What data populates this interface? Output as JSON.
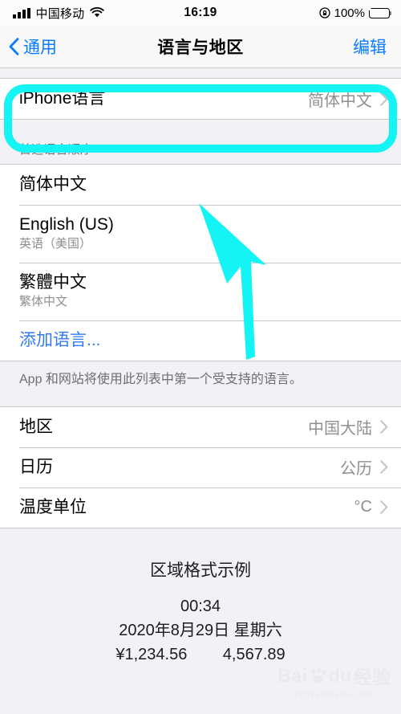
{
  "status_bar": {
    "carrier": "中国移动",
    "time": "16:19",
    "battery_percent": "100%",
    "signal_icon": "signal-bars-icon",
    "wifi_icon": "wifi-icon",
    "rotation_lock_icon": "rotation-lock-icon",
    "battery_icon": "battery-charging-icon"
  },
  "nav": {
    "back_label": "通用",
    "title": "语言与地区",
    "edit_label": "编辑"
  },
  "iphone_language": {
    "label": "iPhone语言",
    "value": "简体中文"
  },
  "preferred_order": {
    "header": "首选语言顺序",
    "items": [
      {
        "title": "简体中文",
        "subtitle": ""
      },
      {
        "title": "English (US)",
        "subtitle": "英语（美国）"
      },
      {
        "title": "繁體中文",
        "subtitle": "繁体中文"
      }
    ],
    "add_language": "添加语言...",
    "footer": "App 和网站将使用此列表中第一个受支持的语言。"
  },
  "region_settings": [
    {
      "label": "地区",
      "value": "中国大陆"
    },
    {
      "label": "日历",
      "value": "公历"
    },
    {
      "label": "温度单位",
      "value": "°C"
    }
  ],
  "region_format_example": {
    "title": "区域格式示例",
    "time": "00:34",
    "date": "2020年8月29日 星期六",
    "numbers": "¥1,234.56        4,567.89"
  },
  "annotations": {
    "highlight_color": "#15f4f4",
    "arrow_color": "#15f4f4",
    "highlight_target": "iPhone语言",
    "arrow_target": "首选语言顺序"
  },
  "watermark": {
    "brand": "Bai",
    "brand2": "du",
    "cn": "经验",
    "url": "jingyan.baidu.com"
  },
  "colors": {
    "accent_blue": "#0a7cff",
    "value_gray": "#8e8e93",
    "page_bg": "#f2f2f6",
    "battery_green": "#4cd964"
  }
}
